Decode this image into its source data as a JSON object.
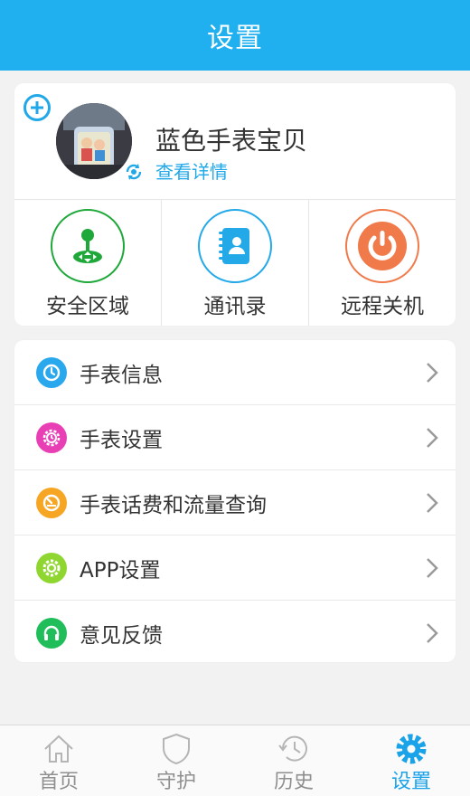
{
  "header": {
    "title": "设置"
  },
  "profile": {
    "name": "蓝色手表宝贝",
    "detail_link": "查看详情"
  },
  "actions": [
    {
      "label": "安全区域",
      "icon": "joystick-icon",
      "color": "#1fa83a"
    },
    {
      "label": "通讯录",
      "icon": "contacts-book-icon",
      "color": "#23a9e8"
    },
    {
      "label": "远程关机",
      "icon": "power-icon",
      "color": "#f07a4a"
    }
  ],
  "menu": [
    {
      "label": "手表信息",
      "icon": "watch-icon",
      "color": "#2aa8ee"
    },
    {
      "label": "手表设置",
      "icon": "watch-settings-icon",
      "color": "#e93fb5"
    },
    {
      "label": "手表话费和流量查询",
      "icon": "gauge-icon",
      "color": "#f6a623"
    },
    {
      "label": "APP设置",
      "icon": "gear-icon",
      "color": "#8fd630"
    },
    {
      "label": "意见反馈",
      "icon": "headphones-icon",
      "color": "#1fbe5a"
    }
  ],
  "tabbar": {
    "items": [
      {
        "label": "首页",
        "icon": "home-icon",
        "active": false
      },
      {
        "label": "守护",
        "icon": "shield-icon",
        "active": false
      },
      {
        "label": "历史",
        "icon": "history-icon",
        "active": false
      },
      {
        "label": "设置",
        "icon": "gear-icon",
        "active": true
      }
    ],
    "active_color": "#1aa3e8",
    "inactive_color": "#8f8f8f"
  },
  "colors": {
    "header": "#21b0ef",
    "background": "#f2f2f2",
    "accent": "#21a8e8"
  }
}
